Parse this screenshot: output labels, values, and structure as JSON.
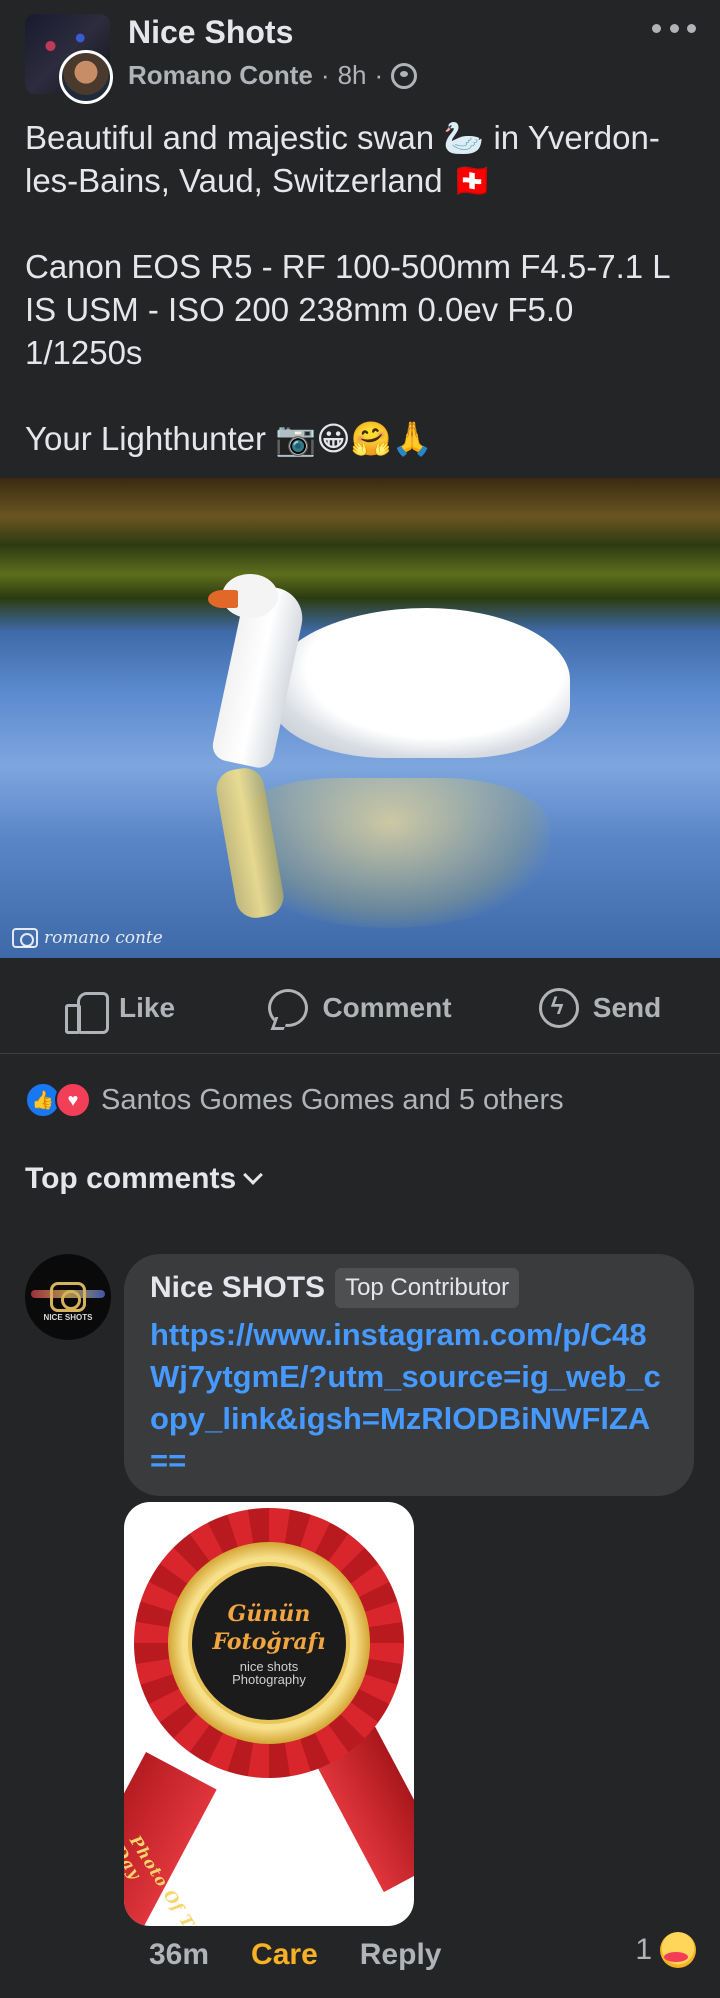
{
  "post": {
    "group_name": "Nice Shots",
    "author": "Romano Conte",
    "time": "8h",
    "separator": "·",
    "text": "Beautiful and majestic swan 🦢 in Yverdon-les-Bains, Vaud, Switzerland 🇨🇭\n\nCanon EOS R5 - RF 100-500mm F4.5-7.1 L IS USM - ISO 200 238mm 0.0ev F5.0 1/1250s\n\nYour Lighthunter 📷😀🤗🙏",
    "image_watermark": "romano conte"
  },
  "actions": {
    "like": "Like",
    "comment": "Comment",
    "send": "Send"
  },
  "reactions": {
    "summary": "Santos Gomes Gomes and 5 others",
    "like_glyph": "👍",
    "love_glyph": "♥"
  },
  "comments_section": {
    "header": "Top comments"
  },
  "comment": {
    "author": "Nice SHOTS",
    "badge": "Top Contributor",
    "avatar_text": "NICE SHOTS",
    "link": "https://www.instagram.com/p/C48Wj7ytgmE/?utm_source=ig_web_copy_link&igsh=MzRlODBiNWFlZA==",
    "sticker": {
      "line1": "Günün",
      "line2": "Fotoğrafı",
      "logo": "nice shots\nPhotography",
      "ribbon": "Photo Of The Day"
    },
    "time": "36m",
    "reaction_label": "Care",
    "reply_label": "Reply",
    "reaction_count": "1"
  }
}
